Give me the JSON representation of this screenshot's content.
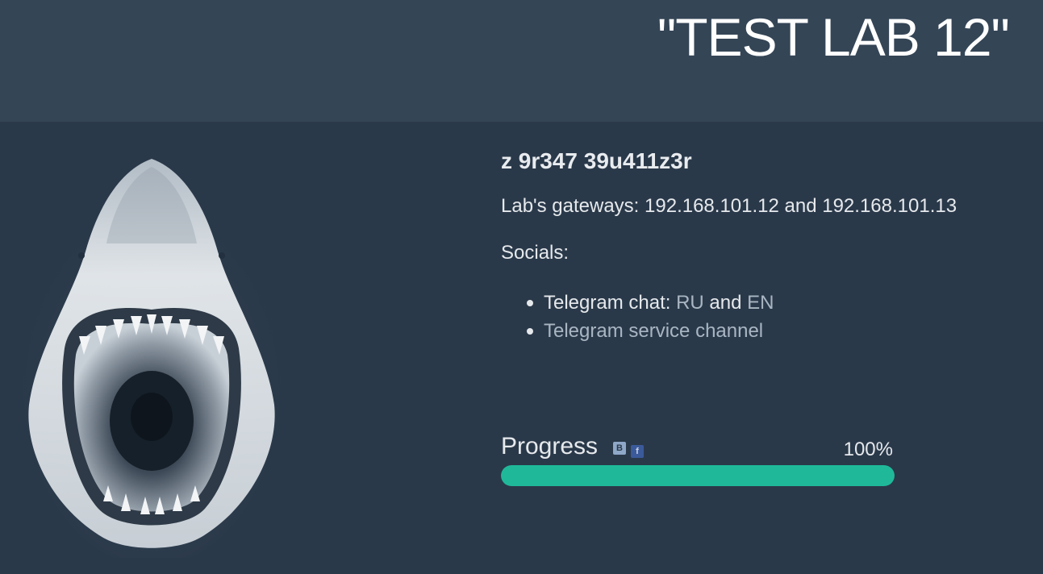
{
  "header": {
    "title": "\"TEST LAB 12\""
  },
  "lab": {
    "heading": "z 9r347 39u411z3r",
    "gateways": "Lab's gateways: 192.168.101.12 and 192.168.101.13",
    "socials_label": "Socials:",
    "socials": {
      "chat_prefix": "Telegram chat: ",
      "ru_link": "RU",
      "and": " and ",
      "en_link": "EN",
      "channel_link": "Telegram service channel"
    }
  },
  "progress": {
    "label": "Progress",
    "percent_text": "100%",
    "fraction": 1.0,
    "share": {
      "vk_letter": "B",
      "fb_letter": "f",
      "vk_icon": "vk-icon",
      "fb_icon": "facebook-icon"
    }
  },
  "colors": {
    "accent": "#1fb99a",
    "header_bg": "#344556",
    "body_bg": "#2a394a",
    "link": "#a9b6c2"
  },
  "image": {
    "icon": "shark-open-jaws-image"
  }
}
